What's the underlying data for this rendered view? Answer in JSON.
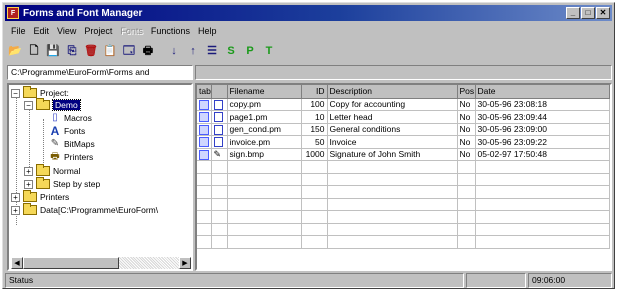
{
  "window": {
    "title": "Forms and Font Manager",
    "buttons": {
      "minimize": "_",
      "maximize": "□",
      "close": "✕"
    }
  },
  "menu": [
    {
      "label": "File",
      "enabled": true
    },
    {
      "label": "Edit",
      "enabled": true
    },
    {
      "label": "View",
      "enabled": true
    },
    {
      "label": "Project",
      "enabled": true
    },
    {
      "label": "Fonts",
      "enabled": false
    },
    {
      "label": "Functions",
      "enabled": true
    },
    {
      "label": "Help",
      "enabled": true
    }
  ],
  "toolbar": {
    "buttons": [
      {
        "icon": "open-folder-icon",
        "glyph": "📂"
      },
      {
        "icon": "new-document-icon",
        "glyph": "🗋"
      },
      {
        "icon": "save-icon",
        "glyph": "💾"
      },
      {
        "icon": "copy-icon",
        "glyph": "⎘"
      },
      {
        "icon": "delete-icon",
        "glyph": "🗑"
      },
      {
        "icon": "paste-icon",
        "glyph": "📋"
      },
      {
        "icon": "properties-icon",
        "glyph": "🗔"
      },
      {
        "icon": "print-icon",
        "glyph": "🖶"
      },
      {
        "icon": "sort-ascending-icon",
        "glyph": "↓"
      },
      {
        "icon": "sort-descending-icon",
        "glyph": "↑"
      },
      {
        "icon": "list-icon",
        "glyph": "☰"
      },
      {
        "icon": "letter-s-icon",
        "glyph": "S"
      },
      {
        "icon": "letter-p-icon",
        "glyph": "P"
      },
      {
        "icon": "letter-t-icon",
        "glyph": "T"
      }
    ],
    "accent_green": "#1a9a1a"
  },
  "path": "C:\\Programme\\EuroForm\\Forms and",
  "tree": {
    "project_label": "Project:",
    "demo_label": "Demo",
    "demo_children": [
      {
        "label": "Macros",
        "icon": "macro-icon"
      },
      {
        "label": "Fonts",
        "icon": "font-icon"
      },
      {
        "label": "BitMaps",
        "icon": "bitmap-icon"
      },
      {
        "label": "Printers",
        "icon": "printer-icon"
      }
    ],
    "normal_label": "Normal",
    "step_label": "Step by step",
    "printers_label": "Printers",
    "data_label": "Data[C:\\Programme\\EuroForm\\"
  },
  "table": {
    "columns": [
      "tab",
      "",
      "Filename",
      "ID",
      "Description",
      "Pos",
      "Date"
    ],
    "rows": [
      {
        "filename": "copy.pm",
        "id": "100",
        "description": "Copy for accounting",
        "pos": "No",
        "date": "30-05-96 23:08:18",
        "kind": "doc"
      },
      {
        "filename": "page1.pm",
        "id": "10",
        "description": "Letter head",
        "pos": "No",
        "date": "30-05-96 23:09:44",
        "kind": "doc"
      },
      {
        "filename": "gen_cond.pm",
        "id": "150",
        "description": "General conditions",
        "pos": "No",
        "date": "30-05-96 23:09:00",
        "kind": "doc"
      },
      {
        "filename": "invoice.pm",
        "id": "50",
        "description": "Invoice",
        "pos": "No",
        "date": "30-05-96 23:09:22",
        "kind": "doc"
      },
      {
        "filename": "sign.bmp",
        "id": "1000",
        "description": "Signature of John Smith",
        "pos": "No",
        "date": "05-02-97 17:50:48",
        "kind": "bitmap"
      }
    ],
    "empty_rows": 7
  },
  "status": {
    "text": "Status",
    "time": "09:06:00"
  }
}
